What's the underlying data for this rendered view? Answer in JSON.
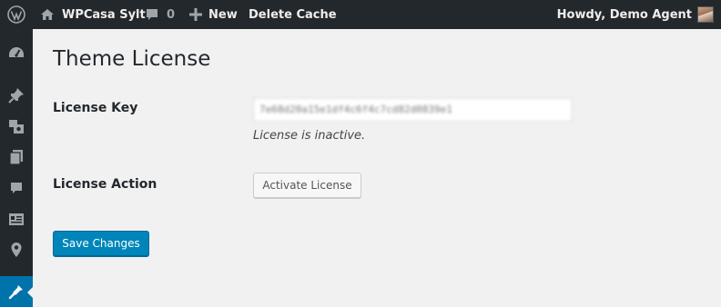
{
  "adminbar": {
    "site_name": "WPCasa Sylt",
    "comments_count": "0",
    "new_label": "New",
    "delete_cache_label": "Delete Cache",
    "greeting": "Howdy, Demo Agent",
    "icons": [
      "wordpress-logo-icon",
      "home-icon",
      "comment-icon",
      "plus-icon"
    ]
  },
  "sidebar": {
    "icons": [
      "dashboard-icon",
      "pin-icon",
      "media-icon",
      "pages-icon",
      "comments-icon",
      "listings-icon",
      "location-icon",
      "appearance-icon"
    ],
    "active": "appearance-icon"
  },
  "main": {
    "title": "Theme License",
    "license_key": {
      "label": "License Key",
      "value": "7e68d20a15e1df4c6f4c7cd82d0839e1",
      "status": "License is inactive."
    },
    "license_action": {
      "label": "License Action",
      "button": "Activate License"
    },
    "save_button": "Save Changes"
  },
  "colors": {
    "adminbar_bg": "#23282d",
    "background": "#f1f1f1",
    "primary_button": "#0085ba",
    "active_menu": "#0073aa"
  }
}
